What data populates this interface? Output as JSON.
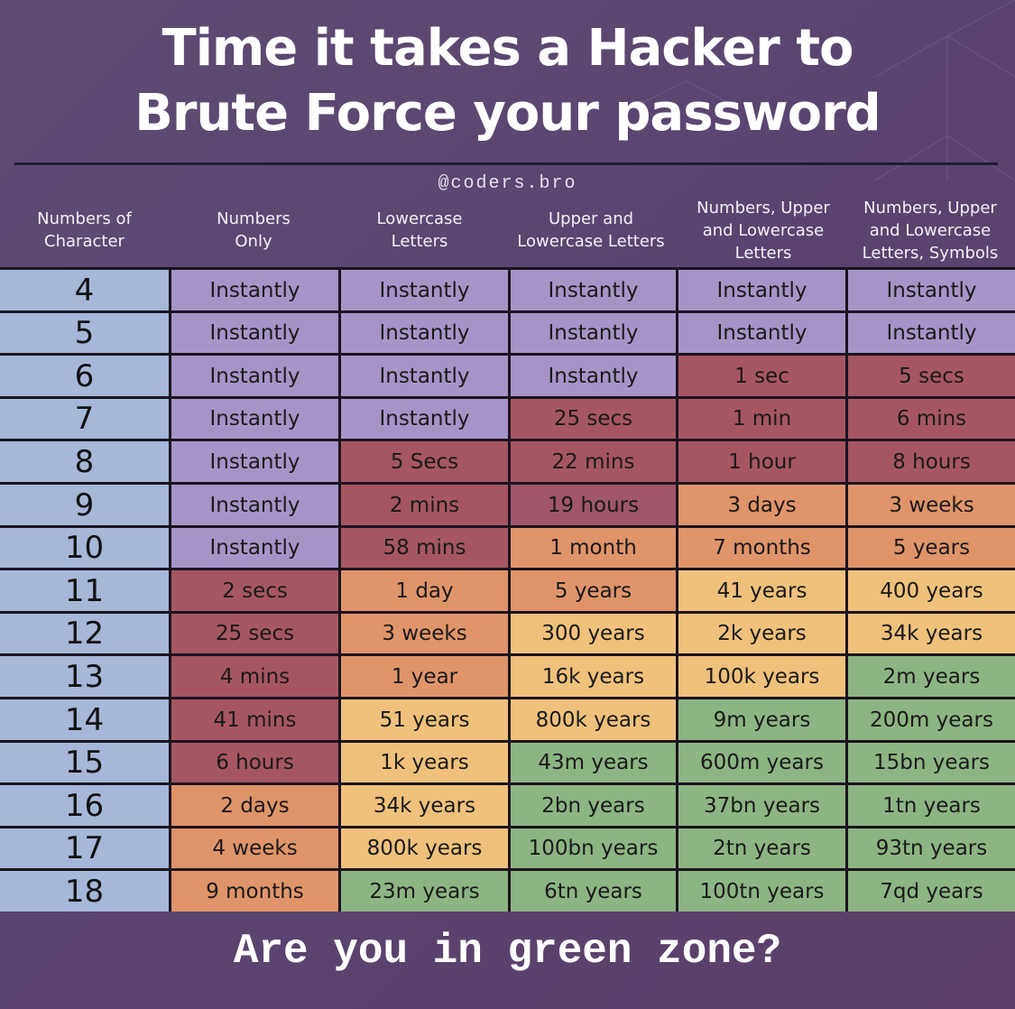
{
  "header": {
    "title_line1": "Time it takes a Hacker to",
    "title_line2": "Brute Force your password",
    "watermark": "@coders.bro"
  },
  "footer": {
    "text": "Are you in green zone?"
  },
  "colors": {
    "background": "#5a4570",
    "label": "#a6b7d8",
    "instant": "#a794c7",
    "red": "#a65662",
    "orange": "#e0946a",
    "yellow": "#efc17c",
    "green": "#8db483"
  },
  "chart_data": {
    "type": "table",
    "title": "Time it takes a Hacker to Brute Force your password",
    "columns": [
      "Numbers of\nCharacter",
      "Numbers\nOnly",
      "Lowercase\nLetters",
      "Upper and\nLowercase Letters",
      "Numbers, Upper\nand Lowercase\nLetters",
      "Numbers, Upper\nand Lowercase\nLetters, Symbols"
    ],
    "rows": [
      {
        "chars": "4",
        "cells": [
          [
            "Instantly",
            "instant"
          ],
          [
            "Instantly",
            "instant"
          ],
          [
            "Instantly",
            "instant"
          ],
          [
            "Instantly",
            "instant"
          ],
          [
            "Instantly",
            "instant"
          ]
        ]
      },
      {
        "chars": "5",
        "cells": [
          [
            "Instantly",
            "instant"
          ],
          [
            "Instantly",
            "instant"
          ],
          [
            "Instantly",
            "instant"
          ],
          [
            "Instantly",
            "instant"
          ],
          [
            "Instantly",
            "instant"
          ]
        ]
      },
      {
        "chars": "6",
        "cells": [
          [
            "Instantly",
            "instant"
          ],
          [
            "Instantly",
            "instant"
          ],
          [
            "Instantly",
            "instant"
          ],
          [
            "1 sec",
            "red"
          ],
          [
            "5 secs",
            "red"
          ]
        ]
      },
      {
        "chars": "7",
        "cells": [
          [
            "Instantly",
            "instant"
          ],
          [
            "Instantly",
            "instant"
          ],
          [
            "25 secs",
            "red"
          ],
          [
            "1 min",
            "red"
          ],
          [
            "6 mins",
            "red"
          ]
        ]
      },
      {
        "chars": "8",
        "cells": [
          [
            "Instantly",
            "instant"
          ],
          [
            "5 Secs",
            "red"
          ],
          [
            "22 mins",
            "red"
          ],
          [
            "1 hour",
            "red"
          ],
          [
            "8 hours",
            "red"
          ]
        ]
      },
      {
        "chars": "9",
        "cells": [
          [
            "Instantly",
            "instant"
          ],
          [
            "2 mins",
            "red"
          ],
          [
            "19 hours",
            "red2"
          ],
          [
            "3 days",
            "orange"
          ],
          [
            "3 weeks",
            "orange"
          ]
        ]
      },
      {
        "chars": "10",
        "cells": [
          [
            "Instantly",
            "instant"
          ],
          [
            "58 mins",
            "red"
          ],
          [
            "1 month",
            "orange"
          ],
          [
            "7 months",
            "orange"
          ],
          [
            "5 years",
            "orange"
          ]
        ]
      },
      {
        "chars": "11",
        "cells": [
          [
            "2 secs",
            "red"
          ],
          [
            "1 day",
            "orange"
          ],
          [
            "5 years",
            "orange"
          ],
          [
            "41 years",
            "yellow"
          ],
          [
            "400 years",
            "yellow"
          ]
        ]
      },
      {
        "chars": "12",
        "cells": [
          [
            "25 secs",
            "red"
          ],
          [
            "3 weeks",
            "orange"
          ],
          [
            "300 years",
            "yellow"
          ],
          [
            "2k years",
            "yellow"
          ],
          [
            "34k years",
            "yellow"
          ]
        ]
      },
      {
        "chars": "13",
        "cells": [
          [
            "4 mins",
            "red"
          ],
          [
            "1 year",
            "orange"
          ],
          [
            "16k years",
            "yellow"
          ],
          [
            "100k years",
            "yellow"
          ],
          [
            "2m years",
            "green"
          ]
        ]
      },
      {
        "chars": "14",
        "cells": [
          [
            "41 mins",
            "red"
          ],
          [
            "51 years",
            "yellow"
          ],
          [
            "800k years",
            "yellow"
          ],
          [
            "9m years",
            "green"
          ],
          [
            "200m years",
            "green"
          ]
        ]
      },
      {
        "chars": "15",
        "cells": [
          [
            "6 hours",
            "red"
          ],
          [
            "1k years",
            "yellow"
          ],
          [
            "43m years",
            "green"
          ],
          [
            "600m years",
            "green"
          ],
          [
            "15bn years",
            "green"
          ]
        ]
      },
      {
        "chars": "16",
        "cells": [
          [
            "2 days",
            "orange"
          ],
          [
            "34k years",
            "yellow"
          ],
          [
            "2bn years",
            "green"
          ],
          [
            "37bn years",
            "green"
          ],
          [
            "1tn years",
            "green"
          ]
        ]
      },
      {
        "chars": "17",
        "cells": [
          [
            "4 weeks",
            "orange"
          ],
          [
            "800k years",
            "yellow"
          ],
          [
            "100bn years",
            "green"
          ],
          [
            "2tn years",
            "green"
          ],
          [
            "93tn years",
            "green"
          ]
        ]
      },
      {
        "chars": "18",
        "cells": [
          [
            "9 months",
            "orange"
          ],
          [
            "23m years",
            "green"
          ],
          [
            "6tn years",
            "green"
          ],
          [
            "100tn years",
            "green"
          ],
          [
            "7qd years",
            "green"
          ]
        ]
      }
    ]
  }
}
